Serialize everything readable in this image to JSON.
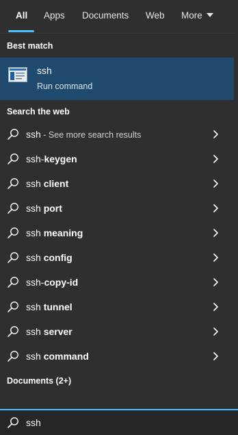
{
  "tabs": [
    {
      "label": "All",
      "active": true
    },
    {
      "label": "Apps"
    },
    {
      "label": "Documents"
    },
    {
      "label": "Web"
    },
    {
      "label": "More"
    }
  ],
  "best_match": {
    "header": "Best match",
    "title": "ssh",
    "subtitle": "Run command",
    "icon": "run-command-icon"
  },
  "web": {
    "header": "Search the web",
    "results": [
      {
        "prefix": "ssh",
        "bold": "",
        "hint": " - See more search results"
      },
      {
        "prefix": "ssh-",
        "bold": "keygen",
        "hint": ""
      },
      {
        "prefix": "ssh ",
        "bold": "client",
        "hint": ""
      },
      {
        "prefix": "ssh ",
        "bold": "port",
        "hint": ""
      },
      {
        "prefix": "ssh ",
        "bold": "meaning",
        "hint": ""
      },
      {
        "prefix": "ssh ",
        "bold": "config",
        "hint": ""
      },
      {
        "prefix": "ssh-",
        "bold": "copy-id",
        "hint": ""
      },
      {
        "prefix": "ssh ",
        "bold": "tunnel",
        "hint": ""
      },
      {
        "prefix": "ssh ",
        "bold": "server",
        "hint": ""
      },
      {
        "prefix": "ssh ",
        "bold": "command",
        "hint": ""
      }
    ]
  },
  "documents": {
    "header": "Documents (2+)"
  },
  "search": {
    "query": "ssh"
  },
  "colors": {
    "accent": "#4cc2ff",
    "selected_bg": "#1f4a6e",
    "panel_bg": "#2f2f2f"
  }
}
